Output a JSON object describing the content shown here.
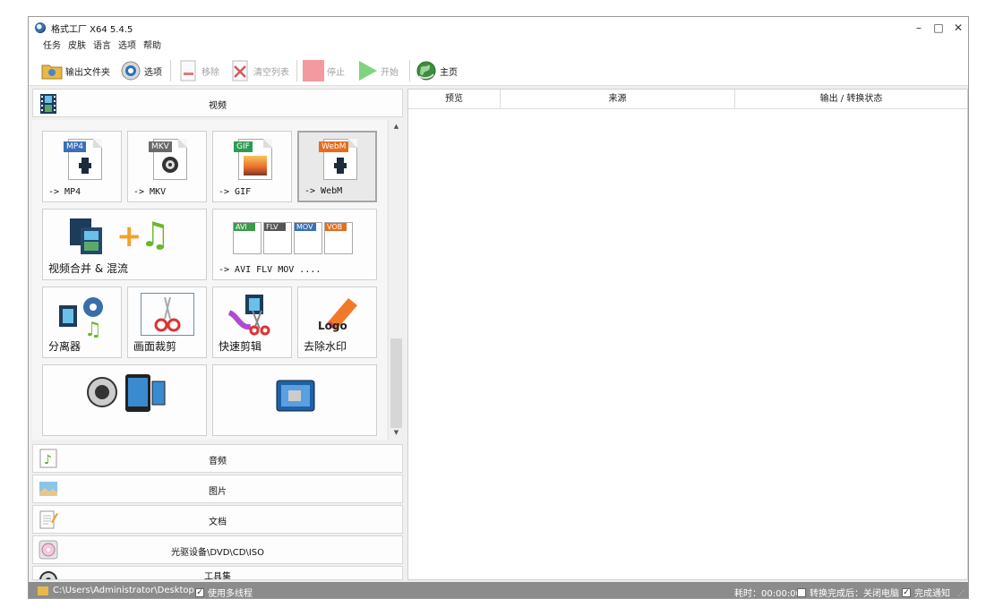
{
  "window": {
    "title": "格式工厂 X64 5.4.5",
    "minimize": "–",
    "maximize": "□",
    "close": "✕"
  },
  "menu": [
    "任务",
    "皮肤",
    "语言",
    "选项",
    "帮助"
  ],
  "toolbar": {
    "output_folder": "输出文件夹",
    "options": "选项",
    "remove": "移除",
    "clear_list": "清空列表",
    "stop": "停止",
    "start": "开始",
    "home": "主页"
  },
  "categories": {
    "video": "视频",
    "audio": "音频",
    "picture": "图片",
    "document": "文档",
    "optical": "光驱设备\\DVD\\CD\\ISO",
    "tools": "工具集"
  },
  "video_tiles": {
    "mp4": {
      "badge": "MP4",
      "label": "-> MP4"
    },
    "mkv": {
      "badge": "MKV",
      "label": "-> MKV"
    },
    "gif": {
      "badge": "GIF",
      "label": "-> GIF"
    },
    "webm": {
      "badge": "WebM",
      "label": "-> WebM"
    },
    "merge": {
      "label": "视频合并 & 混流"
    },
    "multi": {
      "label": "-> AVI FLV MOV ....",
      "badges": [
        "AVI",
        "FLV",
        "MOV",
        "VOB"
      ]
    },
    "split": {
      "label": "分离器"
    },
    "crop": {
      "label": "画面裁剪"
    },
    "quick_cut": {
      "label": "快速剪辑"
    },
    "watermark": {
      "label": "去除水印",
      "logo_text": "Logo"
    }
  },
  "table": {
    "columns": [
      "预览",
      "来源",
      "输出 / 转换状态"
    ]
  },
  "status": {
    "path": "C:\\Users\\Administrator\\Desktop",
    "multithread": "使用多线程",
    "multithread_checked": true,
    "elapsed": "耗时：00:00:00",
    "after_convert": "转换完成后：关闭电脑",
    "after_convert_checked": false,
    "notify": "完成通知",
    "notify_checked": true
  },
  "colors": {
    "mp4": "#3b6fb6",
    "mkv": "#6a6a6a",
    "gif": "#2f9a52",
    "webm": "#e56c1c",
    "start_green": "#66cc66",
    "stop_red": "#f29aa0"
  }
}
